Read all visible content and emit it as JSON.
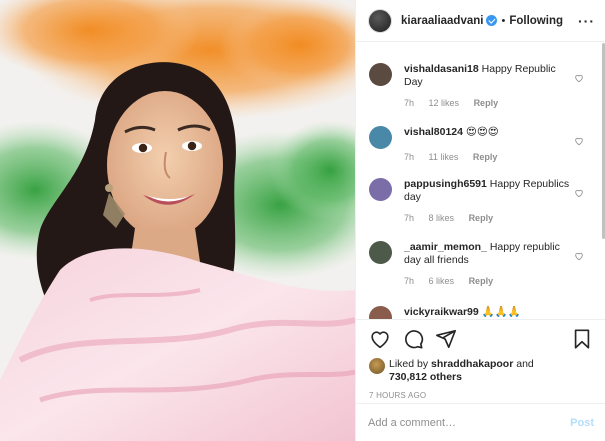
{
  "post": {
    "username": "kiaraaliaadvani",
    "follow_state": "Following",
    "separator": "•",
    "more_label": "···"
  },
  "comments": [
    {
      "user": "vishaldasani18",
      "text": "Happy Republic Day",
      "time": "7h",
      "likes": "12 likes",
      "reply": "Reply",
      "avatar_color": "#5b4a3f"
    },
    {
      "user": "vishal80124",
      "text": "😍😍😍",
      "time": "7h",
      "likes": "11 likes",
      "reply": "Reply",
      "avatar_color": "#4a88a8"
    },
    {
      "user": "pappusingh6591",
      "text": "Happy Republics day",
      "time": "7h",
      "likes": "8 likes",
      "reply": "Reply",
      "avatar_color": "#7b6da8"
    },
    {
      "user": "_aamir_memon_",
      "text": "Happy republic day all friends",
      "time": "7h",
      "likes": "6 likes",
      "reply": "Reply",
      "avatar_color": "#4d5a4a"
    },
    {
      "user": "vickyraikwar99",
      "text": "🙏🙏🙏",
      "time": "",
      "likes": "",
      "reply": "",
      "avatar_color": "#8a5c4c"
    }
  ],
  "likes": {
    "prefix": "Liked by ",
    "liker": "shraddhakapoor",
    "connector": " and",
    "others": "730,812 others"
  },
  "timeago": "7 HOURS AGO",
  "add_comment": {
    "placeholder": "Add a comment…",
    "post_label": "Post"
  },
  "colors": {
    "saffron": "#f28a1e",
    "green": "#2f9e3a",
    "verified_blue": "#3897f0",
    "post_disabled": "#b2dffc"
  }
}
